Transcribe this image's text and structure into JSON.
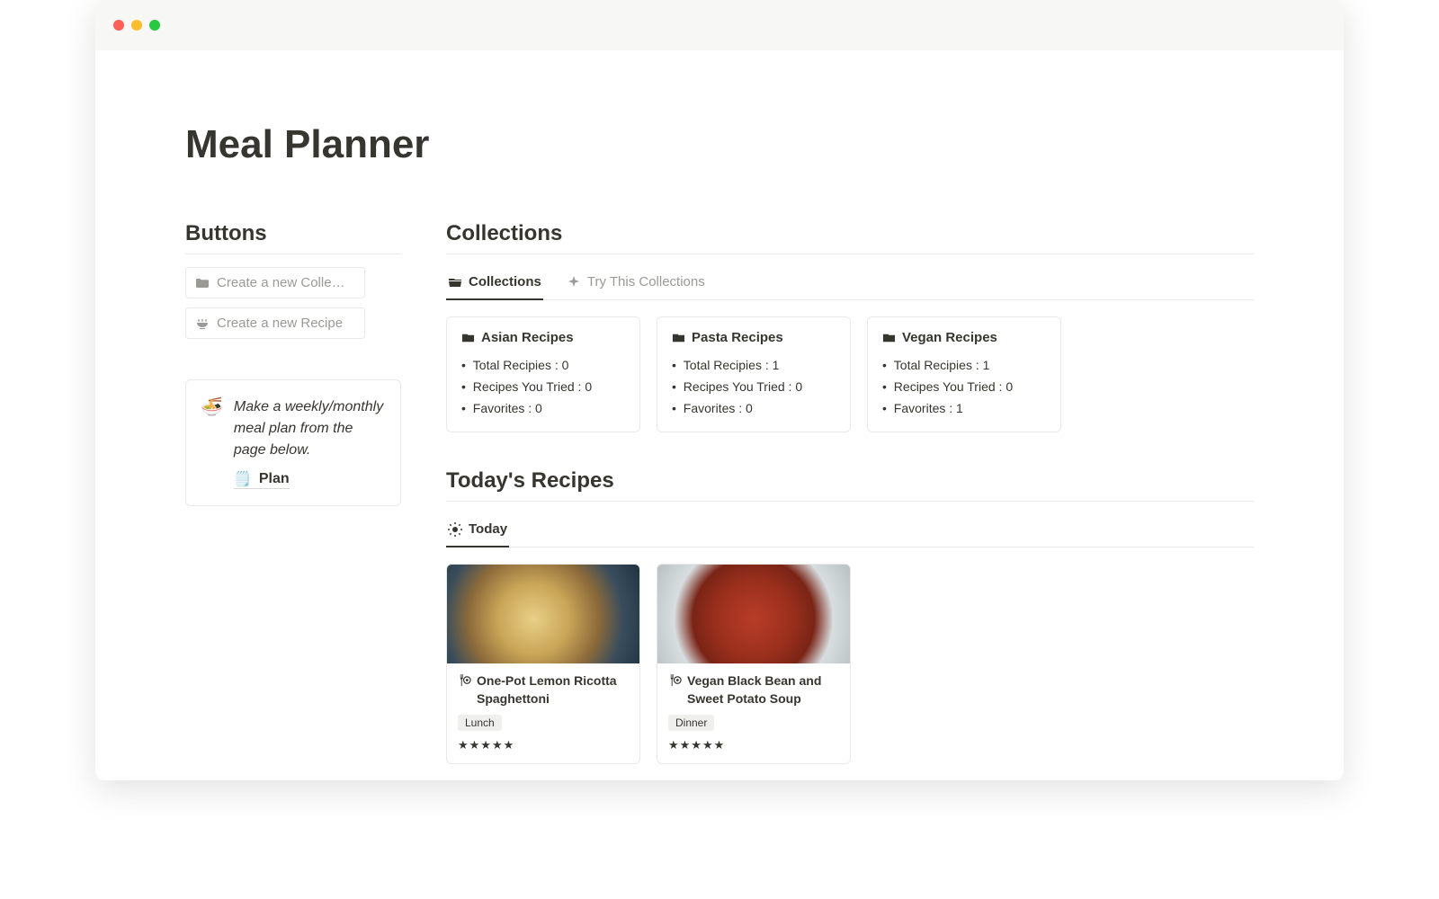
{
  "page": {
    "title": "Meal Planner"
  },
  "sidebar": {
    "heading": "Buttons",
    "buttons": [
      {
        "label": "Create a new Colle…"
      },
      {
        "label": "Create a new Recipe"
      }
    ],
    "callout": {
      "text": "Make a weekly/monthly meal plan from the page below.",
      "plan_label": "Plan"
    }
  },
  "collections": {
    "heading": "Collections",
    "tabs": [
      {
        "label": "Collections",
        "active": true
      },
      {
        "label": "Try This Collections",
        "active": false
      }
    ],
    "cards": [
      {
        "title": "Asian Recipes",
        "stats": [
          "Total Recipies : 0",
          "Recipes You Tried : 0",
          "Favorites : 0"
        ]
      },
      {
        "title": "Pasta Recipes",
        "stats": [
          "Total Recipies : 1",
          "Recipes You Tried : 0",
          "Favorites : 0"
        ]
      },
      {
        "title": "Vegan Recipes",
        "stats": [
          "Total Recipies : 1",
          "Recipes You Tried : 0",
          "Favorites : 1"
        ]
      }
    ]
  },
  "today": {
    "heading": "Today's Recipes",
    "tab_label": "Today",
    "recipes": [
      {
        "title": "One-Pot Lemon Ricotta Spaghettoni",
        "tag": "Lunch",
        "stars": "★★★★★"
      },
      {
        "title": "Vegan Black Bean and Sweet Potato Soup",
        "tag": "Dinner",
        "stars": "★★★★★"
      }
    ]
  }
}
